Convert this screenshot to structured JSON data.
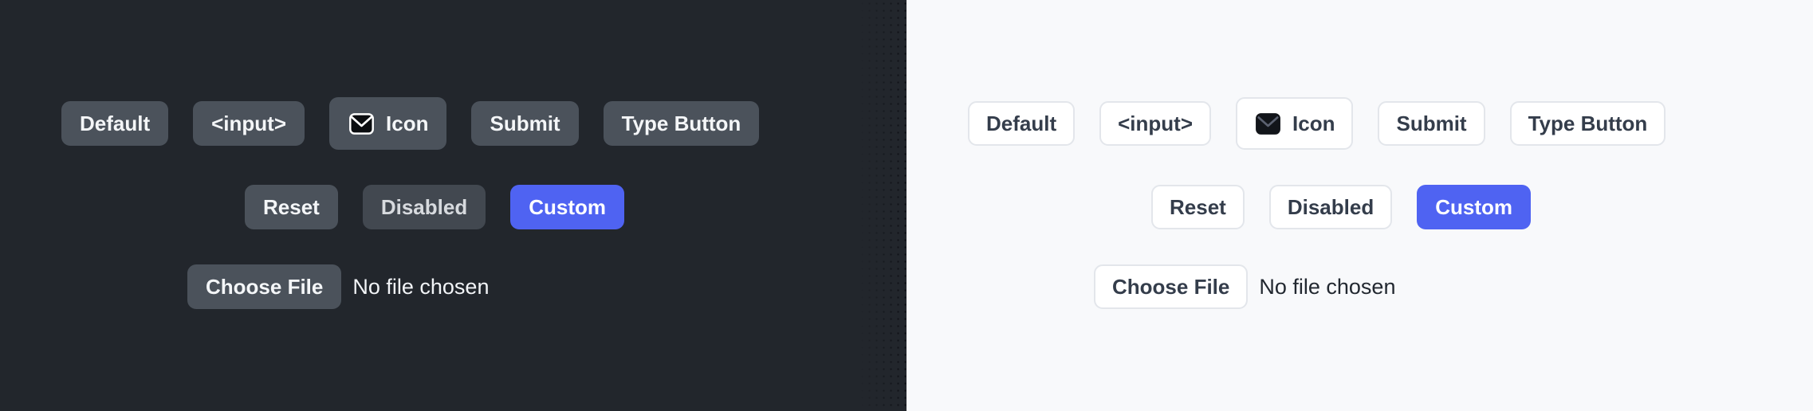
{
  "layout": {
    "panels": [
      "dark",
      "light"
    ],
    "colors": {
      "dark_background": "#22262c",
      "light_background": "#f8f9fb",
      "dark_button_fill": "#4b525b",
      "dark_button_text": "#f4f6f8",
      "light_button_fill": "#ffffff",
      "light_button_border": "#e3e6eb",
      "light_button_text": "#343d4b",
      "accent_custom": "#4f63f2",
      "custom_button_text": "#ffffff"
    }
  },
  "buttons": {
    "row1": [
      {
        "label": "Default",
        "name": "default-button"
      },
      {
        "label": "<input>",
        "name": "input-button"
      },
      {
        "label": "Icon",
        "name": "icon-button",
        "icon": "mail-icon"
      },
      {
        "label": "Submit",
        "name": "submit-button"
      },
      {
        "label": "Type Button",
        "name": "type-button"
      }
    ],
    "row2": [
      {
        "label": "Reset",
        "name": "reset-button"
      },
      {
        "label": "Disabled",
        "name": "disabled-button"
      },
      {
        "label": "Custom",
        "name": "custom-button"
      }
    ]
  },
  "file_input": {
    "button_label": "Choose File",
    "status_text": "No file chosen"
  }
}
